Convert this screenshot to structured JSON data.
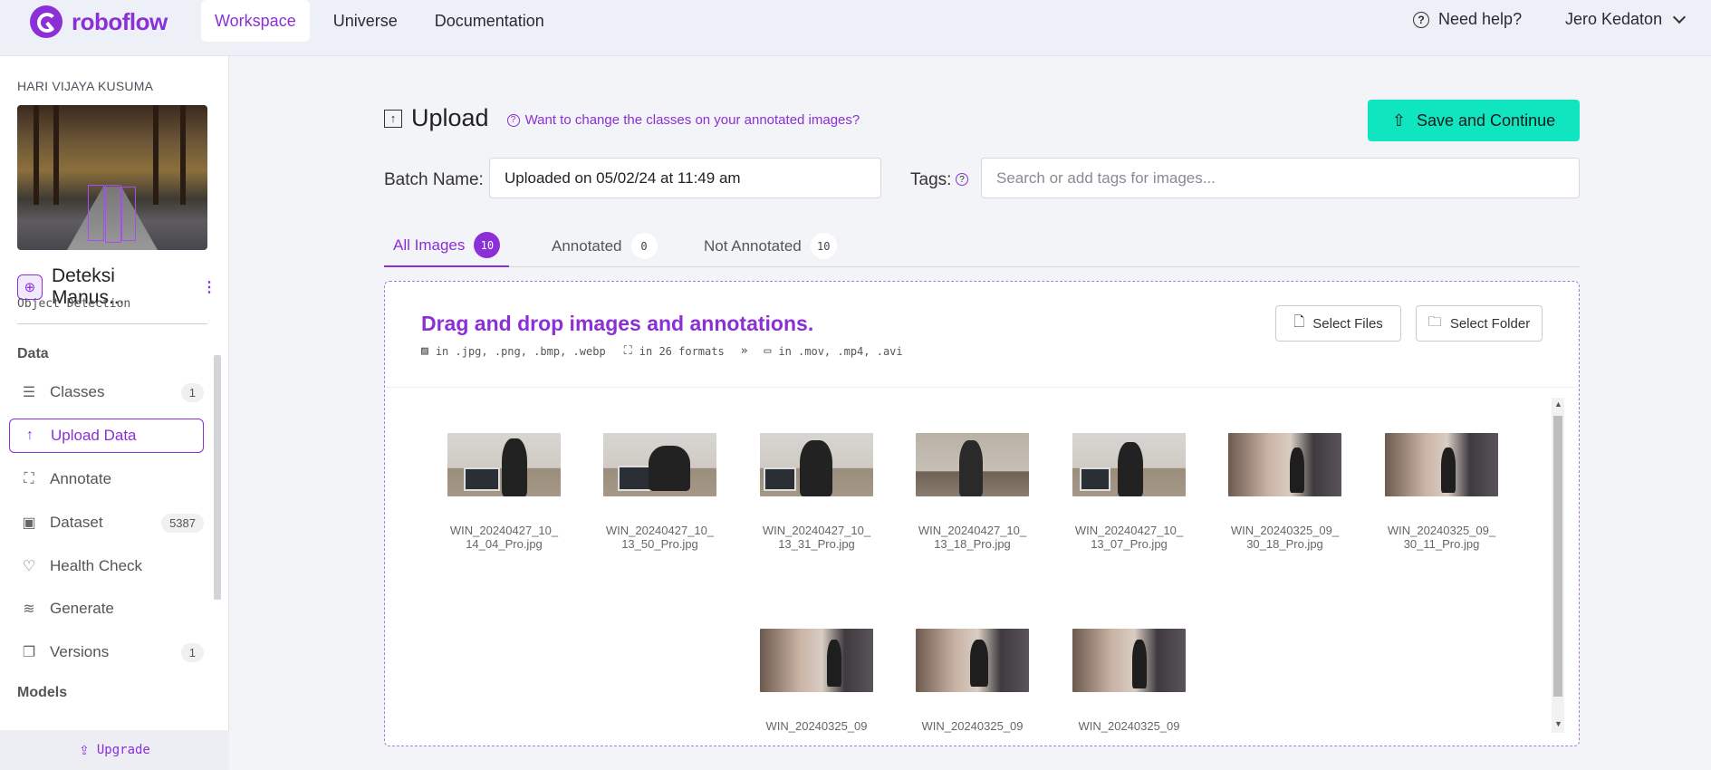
{
  "brand": "roboflow",
  "nav": [
    "Workspace",
    "Universe",
    "Documentation"
  ],
  "help": "Need help?",
  "user": "Jero Kedaton",
  "sidebar": {
    "workspace": "HARI VIJAYA KUSUMA",
    "project_name": "Deteksi Manus...",
    "project_type": "Object Detection",
    "data_section": "Data",
    "models_section": "Models",
    "items": [
      {
        "label": "Classes",
        "count": "1"
      },
      {
        "label": "Upload Data",
        "count": ""
      },
      {
        "label": "Annotate",
        "count": ""
      },
      {
        "label": "Dataset",
        "count": "5387"
      },
      {
        "label": "Health Check",
        "count": ""
      },
      {
        "label": "Generate",
        "count": ""
      },
      {
        "label": "Versions",
        "count": "1"
      }
    ],
    "upgrade": "Upgrade"
  },
  "main": {
    "title": "Upload",
    "classes_link": "Want to change the classes on your annotated images?",
    "save_button": "Save and Continue",
    "batch_label": "Batch Name:",
    "batch_value": "Uploaded on 05/02/24 at 11:49 am",
    "tags_label": "Tags:",
    "tags_placeholder": "Search or add tags for images...",
    "tabs": [
      {
        "label": "All Images",
        "count": "10"
      },
      {
        "label": "Annotated",
        "count": "0"
      },
      {
        "label": "Not Annotated",
        "count": "10"
      }
    ],
    "dropzone": {
      "title": "Drag and drop images and annotations.",
      "images_formats": "in .jpg, .png, .bmp, .webp",
      "annotation_formats": "in 26 formats",
      "video_formats": "in .mov, .mp4, .avi",
      "select_files": "Select Files",
      "select_folder": "Select Folder"
    },
    "files": [
      "WIN_20240427_10_14_04_Pro.jpg",
      "WIN_20240427_10_13_50_Pro.jpg",
      "WIN_20240427_10_13_31_Pro.jpg",
      "WIN_20240427_10_13_18_Pro.jpg",
      "WIN_20240427_10_13_07_Pro.jpg",
      "WIN_20240325_09_30_18_Pro.jpg",
      "WIN_20240325_09_30_11_Pro.jpg",
      "WIN_20240325_09",
      "WIN_20240325_09",
      "WIN_20240325_09"
    ]
  }
}
